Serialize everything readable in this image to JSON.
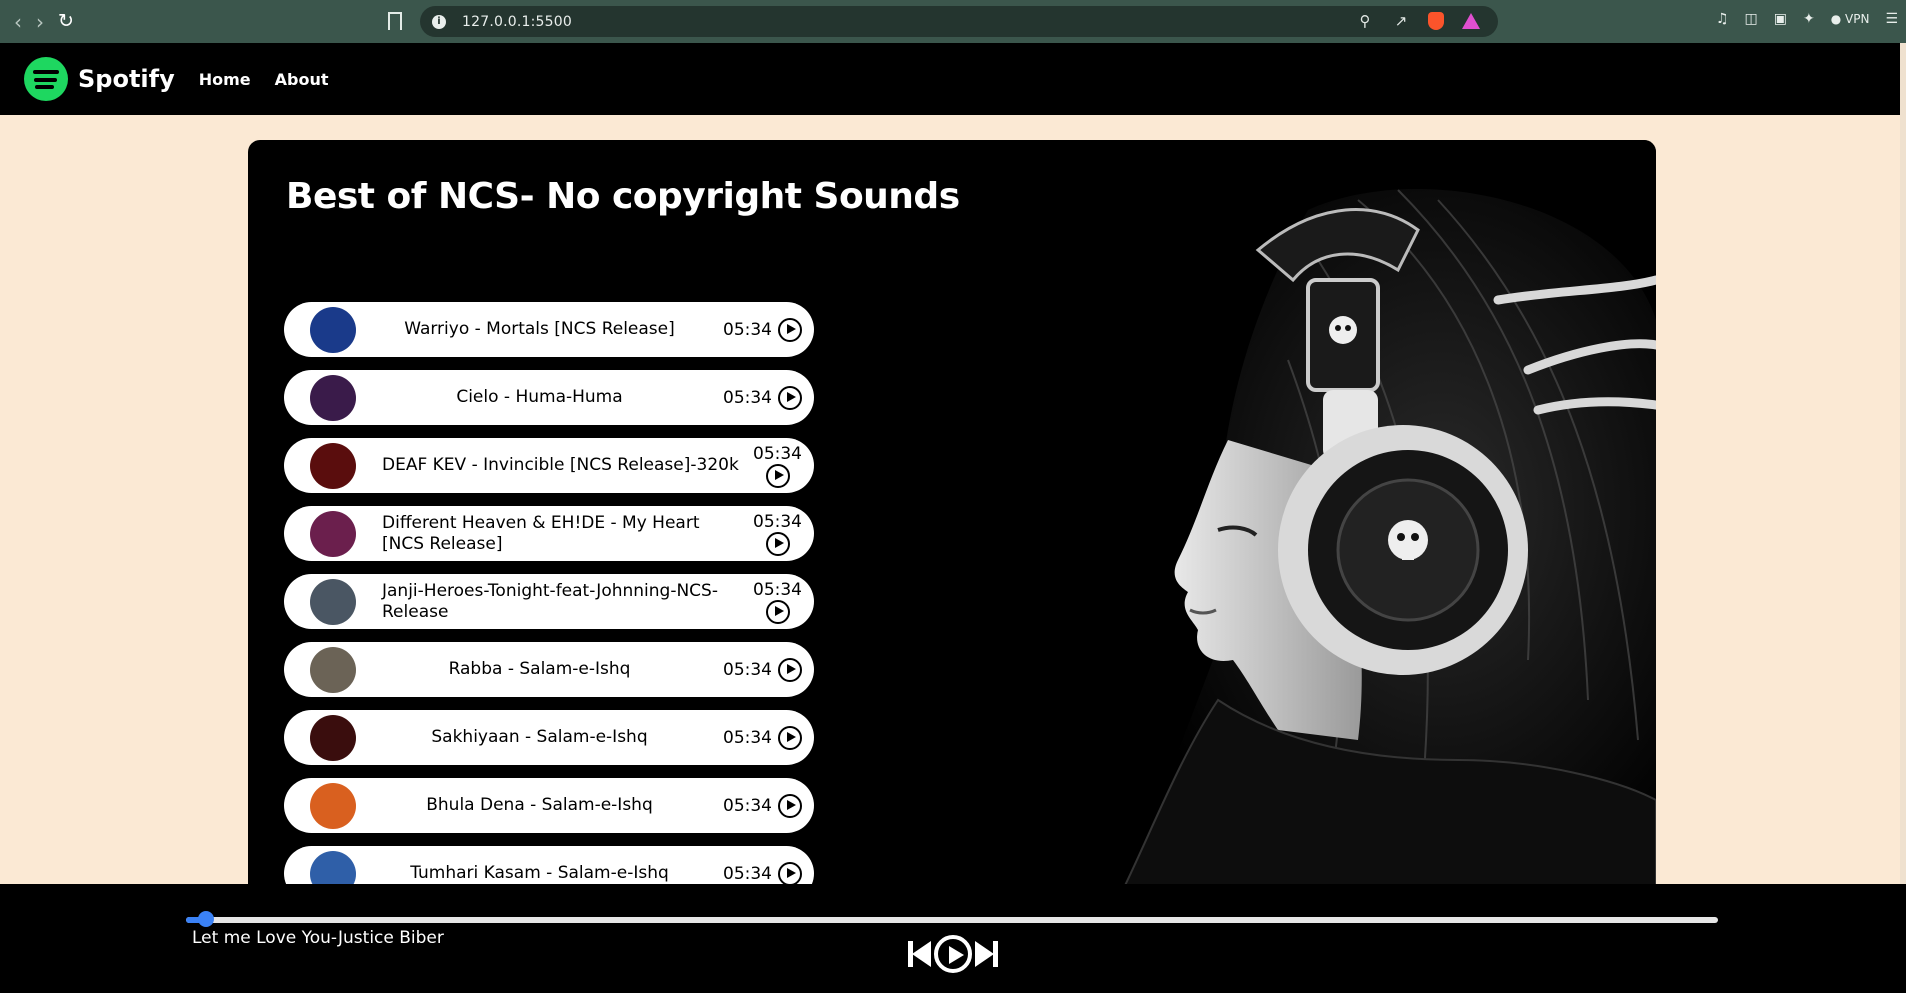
{
  "browser": {
    "url": "127.0.0.1:5500",
    "vpn_label": "VPN"
  },
  "nav": {
    "brand": "Spotify",
    "links": [
      "Home",
      "About"
    ]
  },
  "main": {
    "title": "Best of NCS- No copyright Sounds",
    "songs": [
      {
        "name": "Warriyo - Mortals [NCS Release]",
        "duration": "05:34",
        "cover_color": "#1a3a8a"
      },
      {
        "name": "Cielo - Huma-Huma",
        "duration": "05:34",
        "cover_color": "#3a1b4a"
      },
      {
        "name": "DEAF KEV - Invincible [NCS Release]-320k",
        "duration": "05:34",
        "cover_color": "#5a0d0d"
      },
      {
        "name": "Different Heaven & EH!DE - My Heart [NCS Release]",
        "duration": "05:34",
        "cover_color": "#6b1f4d"
      },
      {
        "name": "Janji-Heroes-Tonight-feat-Johnning-NCS-Release",
        "duration": "05:34",
        "cover_color": "#4a5663"
      },
      {
        "name": "Rabba - Salam-e-Ishq",
        "duration": "05:34",
        "cover_color": "#6b6356"
      },
      {
        "name": "Sakhiyaan - Salam-e-Ishq",
        "duration": "05:34",
        "cover_color": "#3a0d0d"
      },
      {
        "name": "Bhula Dena - Salam-e-Ishq",
        "duration": "05:34",
        "cover_color": "#d9601f"
      },
      {
        "name": "Tumhari Kasam - Salam-e-Ishq",
        "duration": "05:34",
        "cover_color": "#2f5fa8"
      }
    ]
  },
  "player": {
    "now_playing": "Let me Love You-Justice Biber",
    "progress_percent": 1.5
  },
  "colors": {
    "spotify_green": "#1ed760",
    "page_bg": "#fbe9d4",
    "progress_blue": "#3b82f6"
  }
}
